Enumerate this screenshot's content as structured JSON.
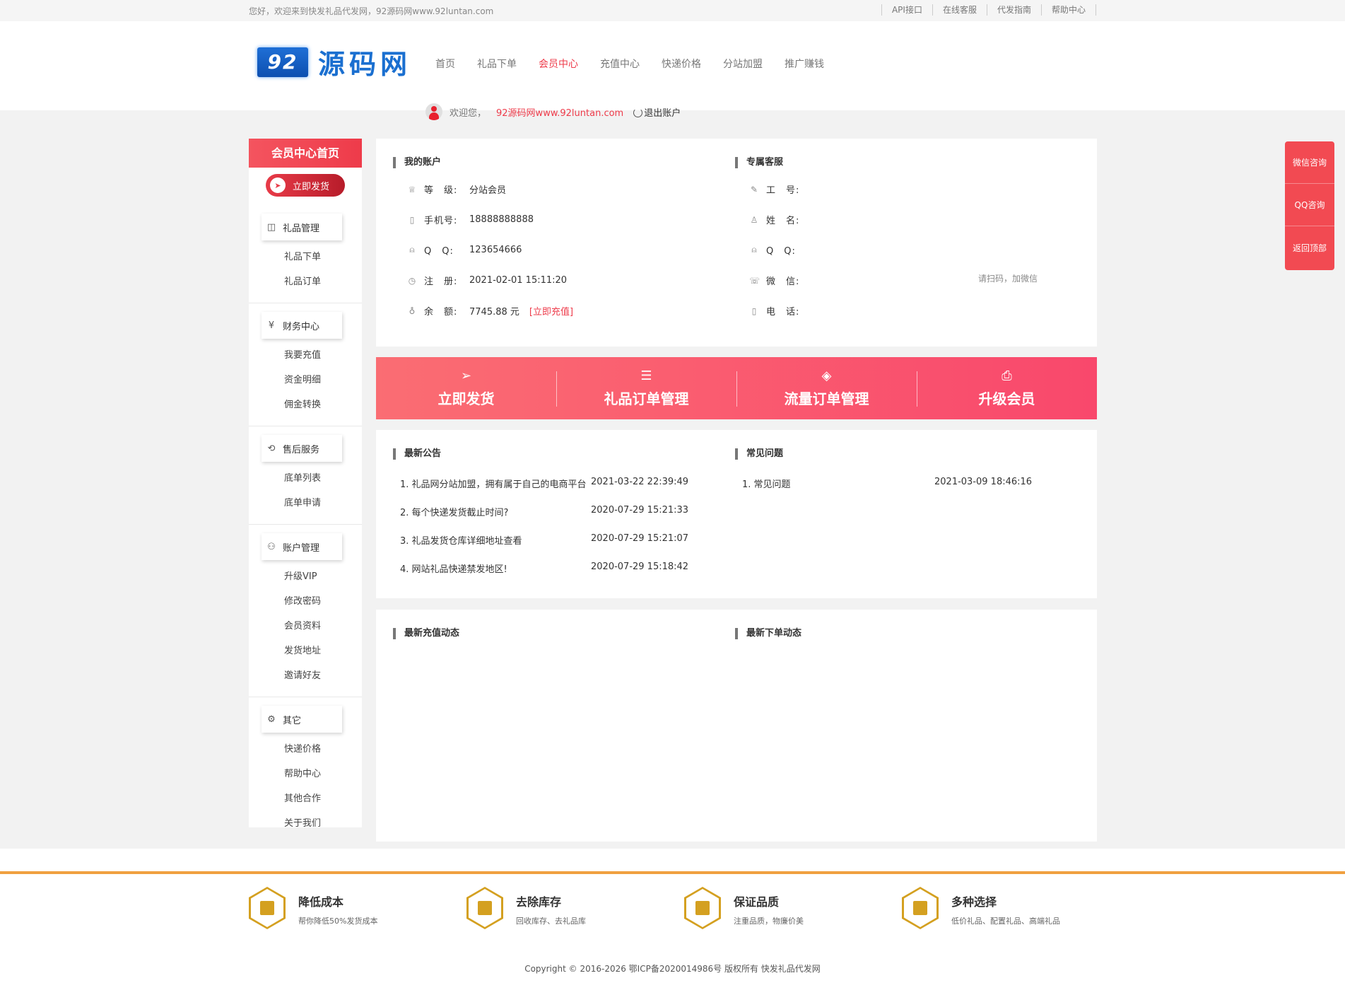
{
  "topbar": {
    "welcome": "您好，欢迎来到快发礼品代发网，92源码网www.92luntan.com",
    "links": [
      "API接口",
      "在线客服",
      "代发指南",
      "帮助中心"
    ]
  },
  "header": {
    "logo_badge": "92",
    "logo_text": "源码网",
    "nav": [
      "首页",
      "礼品下单",
      "会员中心",
      "充值中心",
      "快递价格",
      "分站加盟",
      "推广赚钱"
    ],
    "nav_active": "会员中心",
    "welcome": "欢迎您，",
    "username": "92源码网www.92luntan.com",
    "logout": "退出账户"
  },
  "sidebar": {
    "head": "会员中心首页",
    "send_button": "立即发货",
    "groups": [
      {
        "title": "礼品管理",
        "icon": "bag-icon",
        "items": [
          "礼品下单",
          "礼品订单"
        ]
      },
      {
        "title": "财务中心",
        "icon": "yen-icon",
        "items": [
          "我要充值",
          "资金明细",
          "佣金转换"
        ]
      },
      {
        "title": "售后服务",
        "icon": "service-icon",
        "items": [
          "底单列表",
          "底单申请"
        ]
      },
      {
        "title": "账户管理",
        "icon": "users-icon",
        "items": [
          "升级VIP",
          "修改密码",
          "会员资料",
          "发货地址",
          "邀请好友"
        ]
      },
      {
        "title": "其它",
        "icon": "gear-icon",
        "items": [
          "快递价格",
          "帮助中心",
          "其他合作",
          "关于我们"
        ]
      }
    ]
  },
  "account": {
    "title": "我的账户",
    "rows": [
      {
        "label": "等　级:",
        "value": "分站会员"
      },
      {
        "label": "手机号:",
        "value": "18888888888"
      },
      {
        "label": "Q　Q:",
        "value": "123654666"
      },
      {
        "label": "注　册:",
        "value": "2021-02-01 15:11:20"
      },
      {
        "label": "余　额:",
        "value": "7745.88 元"
      }
    ],
    "recharge": "[立即充值]"
  },
  "service": {
    "title": "专属客服",
    "rows": [
      {
        "label": "工　号:",
        "value": ""
      },
      {
        "label": "姓　名:",
        "value": ""
      },
      {
        "label": "Q　Q:",
        "value": ""
      },
      {
        "label": "微　信:",
        "value": ""
      },
      {
        "label": "电　话:",
        "value": ""
      }
    ],
    "qr_note": "请扫码，加微信"
  },
  "actions": [
    "立即发货",
    "礼品订单管理",
    "流量订单管理",
    "升级会员"
  ],
  "notices": {
    "title": "最新公告",
    "items": [
      {
        "text": "1. 礼品网分站加盟，拥有属于自己的电商平台",
        "date": "2021-03-22 22:39:49"
      },
      {
        "text": "2. 每个快递发货截止时间?",
        "date": "2020-07-29 15:21:33"
      },
      {
        "text": "3. 礼品发货仓库详细地址查看",
        "date": "2020-07-29 15:21:07"
      },
      {
        "text": "4. 网站礼品快递禁发地区!",
        "date": "2020-07-29 15:18:42"
      }
    ]
  },
  "faq": {
    "title": "常见问题",
    "items": [
      {
        "text": "1. 常见问题",
        "date": "2021-03-09 18:46:16"
      }
    ]
  },
  "activity": {
    "recharge_title": "最新充值动态",
    "order_title": "最新下单动态"
  },
  "float_bar": [
    "微信咨询",
    "QQ咨询",
    "返回顶部"
  ],
  "features": [
    {
      "title": "降低成本",
      "desc": "帮你降低50%发货成本"
    },
    {
      "title": "去除库存",
      "desc": "回收库存、去礼品库"
    },
    {
      "title": "保证品质",
      "desc": "注重品质，物廉价美"
    },
    {
      "title": "多种选择",
      "desc": "低价礼品、配置礼品、高端礼品"
    }
  ],
  "copyright": "Copyright © 2016-2026 鄂ICP备2020014986号 版权所有 快发礼品代发网",
  "colors": {
    "accent": "#ee3b4a",
    "gold": "#d4a020",
    "footer_line": "#f0a040"
  }
}
